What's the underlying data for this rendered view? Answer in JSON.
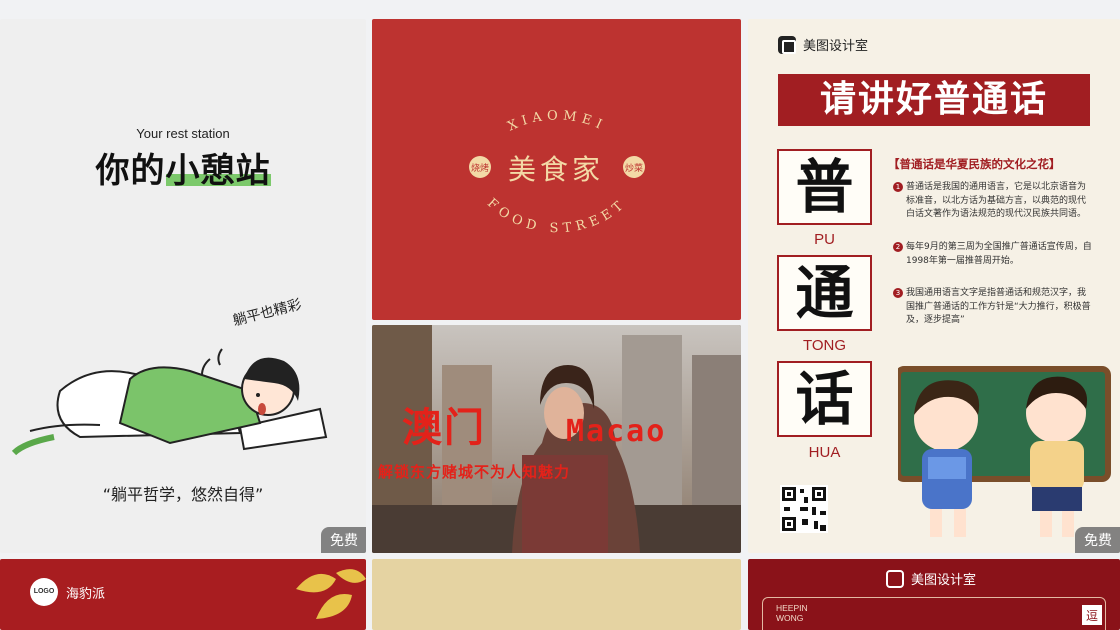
{
  "cards": [
    {
      "subtitle": "Your rest station",
      "title_prefix": "你的",
      "title_highlight": "小憩站",
      "tag": "躺平也精彩",
      "quote": "“躺平哲学，悠然自得”",
      "badge": "免费"
    },
    {
      "arc_top": "XIAOMEI",
      "arc_bottom": "FOOD STREET",
      "title": "美食家",
      "left_seal": "烧烤",
      "right_seal": "炒菜"
    },
    {
      "brand": "美图设计室",
      "banner": "请讲好普通话",
      "chars": [
        {
          "char": "普",
          "pinyin": "PU"
        },
        {
          "char": "通",
          "pinyin": "TONG"
        },
        {
          "char": "话",
          "pinyin": "HUA"
        }
      ],
      "subtitle": "【普通话是华夏民族的文化之花】",
      "points": [
        {
          "num": "1",
          "text": "普通话是我国的通用语言，它是以北京语音为标准音，以北方话为基础方言，以典范的现代白话文著作为语法规范的现代汉民族共同语。"
        },
        {
          "num": "2",
          "text": "每年9月的第三周为全国推广普通话宣传周，自1998年第一届推普周开始。"
        },
        {
          "num": "3",
          "text": "我国通用语言文字是指普通话和规范汉字，我国推广普通话的工作方针是“大力推行，积极普及，逐步提高”"
        }
      ],
      "badge": "免费"
    },
    {
      "title_cn": "澳门",
      "title_en": "Macao",
      "subtitle": "解锁东方赌城不为人知魅力"
    },
    {
      "logo": "LOGO",
      "name": "海豹派"
    },
    {},
    {
      "brand": "美图设计室",
      "heading": "HEEPIN WONG",
      "side_char": "逗"
    }
  ],
  "colors": {
    "food_red": "#bd3330",
    "banner_red": "#a11e22",
    "green_accent": "#7cc96b",
    "deep_red": "#8a1219"
  }
}
